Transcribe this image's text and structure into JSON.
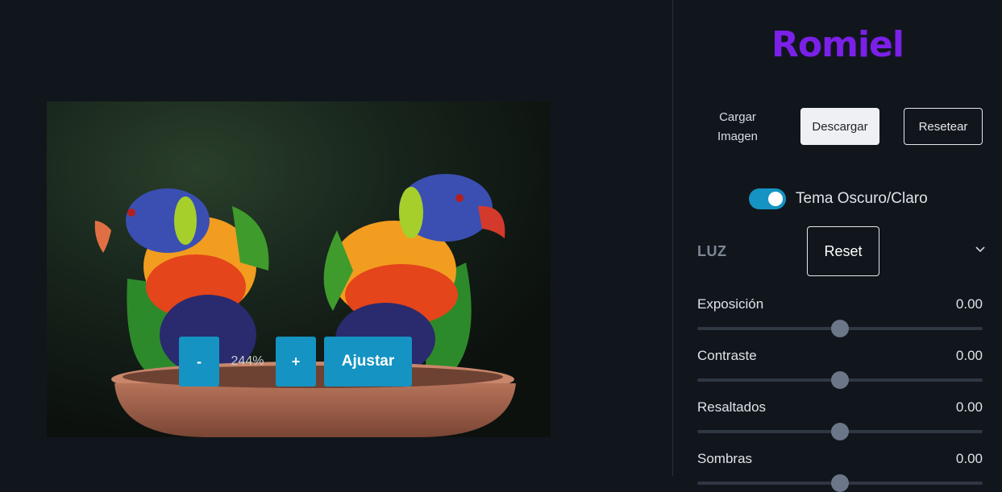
{
  "brand": {
    "name": "Romiel",
    "color": "#7b20e8"
  },
  "canvas": {
    "zoom_out_label": "-",
    "zoom_level": "244%",
    "zoom_in_label": "+",
    "fit_label": "Ajustar"
  },
  "toolbar": {
    "load_label": "Cargar Imagen",
    "download_label": "Descargar",
    "reset_all_label": "Resetear"
  },
  "theme": {
    "toggle_label": "Tema Oscuro/Claro",
    "enabled": true
  },
  "section": {
    "title": "LUZ",
    "reset_label": "Reset",
    "expand_icon": "chevron-down-icon"
  },
  "sliders": [
    {
      "label": "Exposición",
      "value": "0.00",
      "level": 0.5
    },
    {
      "label": "Contraste",
      "value": "0.00",
      "level": 0.5
    },
    {
      "label": "Resaltados",
      "value": "0.00",
      "level": 0.5
    },
    {
      "label": "Sombras",
      "value": "0.00",
      "level": 0.5
    }
  ],
  "colors": {
    "accent": "#1593c2",
    "background": "#11161d",
    "slider_thumb": "#6b7788"
  }
}
